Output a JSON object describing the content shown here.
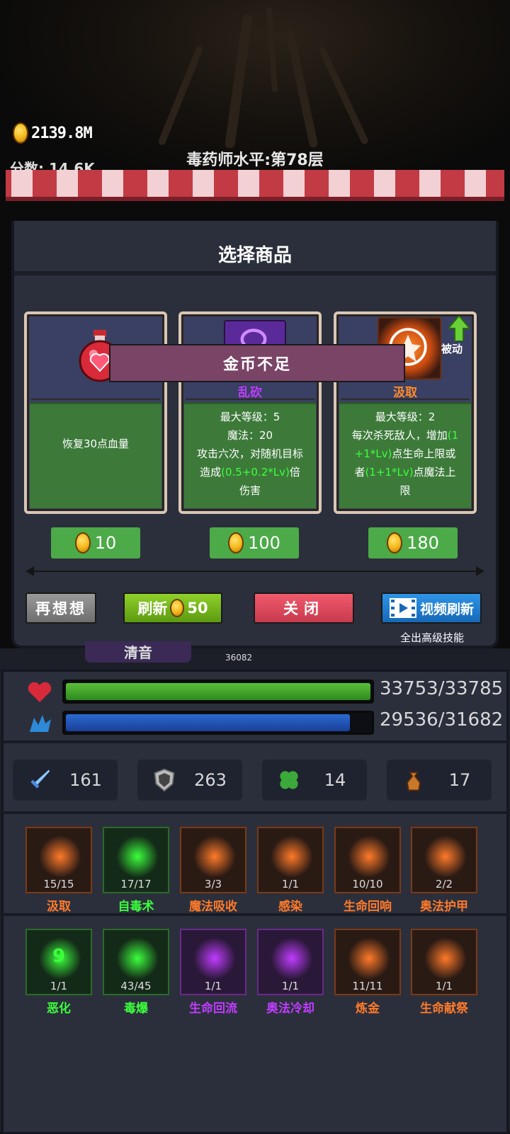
{
  "hud": {
    "coins": "2139.8M",
    "score": "分数: 14.6K",
    "level_title": "毒药师水平:第78层"
  },
  "shop": {
    "title": "选择商品",
    "toast": "金币不足",
    "cards": [
      {
        "name": "",
        "desc": "恢复30点血量",
        "price": "10",
        "icon": "health-potion-icon"
      },
      {
        "name": "乱砍",
        "name_color": "#c03cff",
        "desc_lines": [
          "最大等级：5",
          "魔法：20",
          "攻击六次，对随机目标",
          "造成",
          "(0.5+0.2*Lv)",
          "倍",
          "伤害"
        ],
        "price": "100",
        "icon": "purple-slash-icon"
      },
      {
        "name": "汲取",
        "name_color": "#ff8a2a",
        "tag": "被动",
        "desc_lines": [
          "最大等级：2",
          "每次杀死敌人，增加",
          "(1",
          "+1*Lv)",
          "点生命上限或",
          "者",
          "(1+1*Lv)",
          "点魔法上",
          "限"
        ],
        "price": "180",
        "icon": "drain-skill-icon"
      }
    ],
    "buttons": {
      "rethink": "再想想",
      "refresh": "刷新",
      "refresh_cost": "50",
      "close": "关闭",
      "video": "视频刷新"
    },
    "hint": "全出高级技能",
    "behind_label": "清音",
    "behind_count": "36082"
  },
  "stats": {
    "hp": {
      "current": "33753/33785",
      "fill": 0.999
    },
    "mp": {
      "current": "29536/31682",
      "fill": 0.932
    },
    "attack": "161",
    "defense": "263",
    "luck": "14",
    "gold_bag": "17"
  },
  "skills_row1": [
    {
      "name": "汲取",
      "count": "15/15",
      "color": "#ff7a2a"
    },
    {
      "name": "自毒术",
      "count": "17/17",
      "color": "#3cff3c"
    },
    {
      "name": "魔法吸收",
      "count": "3/3",
      "color": "#ff7a2a"
    },
    {
      "name": "感染",
      "count": "1/1",
      "color": "#ff7a2a"
    },
    {
      "name": "生命回响",
      "count": "10/10",
      "color": "#ff7a2a"
    },
    {
      "name": "奥法护甲",
      "count": "2/2",
      "color": "#ff7a2a"
    }
  ],
  "skills_row2": [
    {
      "name": "恶化",
      "count": "1/1",
      "color": "#3cff3c",
      "badge": "9"
    },
    {
      "name": "毒爆",
      "count": "43/45",
      "color": "#3cff3c"
    },
    {
      "name": "生命回流",
      "count": "1/1",
      "color": "#c03cff"
    },
    {
      "name": "奥法冷却",
      "count": "1/1",
      "color": "#c03cff"
    },
    {
      "name": "炼金",
      "count": "11/11",
      "color": "#ff7a2a"
    },
    {
      "name": "生命献祭",
      "count": "1/1",
      "color": "#ff7a2a"
    }
  ]
}
